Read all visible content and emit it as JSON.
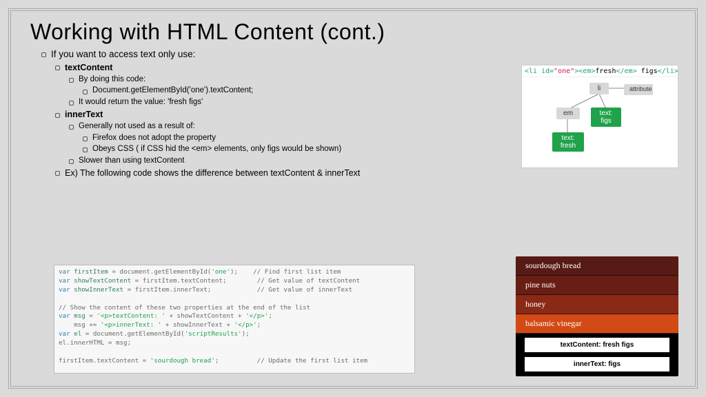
{
  "title": "Working with HTML Content (cont.)",
  "bullets": {
    "intro": "If you want to access text only use:",
    "textContent": {
      "label": "textContent",
      "sub1": "By doing this code:",
      "code": "Document.getElementById('one').textContent;",
      "sub2": "It would return the value: 'fresh figs'"
    },
    "innerText": {
      "label": "innerText",
      "sub1": "Generally not used as a result of:",
      "f1": "Firefox does not adopt the property",
      "f2": "Obeys CSS ( if CSS hid the <em> elements, only figs would be shown)",
      "f3": "Slower than using textContent"
    },
    "ex": "Ex) The following code shows the difference between textContent & innerText"
  },
  "diagram": {
    "codeline_html": "<li id=\"one\"><em>fresh</em> figs</li>",
    "node_li": "li",
    "node_attr": "attribute",
    "node_em": "em",
    "node_text_figs": "text: figs",
    "node_text_fresh": "text: fresh"
  },
  "code_block": {
    "l1": "var firstItem = document.getElementById('one');    // Find first list item",
    "l2": "var showTextContent = firstItem.textContent;        // Get value of textContent",
    "l3": "var showInnerText = firstItem.innerText;            // Get value of innerText",
    "l4": "",
    "l5": "// Show the content of these two properties at the end of the list",
    "l6": "var msg = '<p>textContent: ' + showTextContent + '</p>';",
    "l7": "    msg += '<p>innerText: ' + showInnerText + '</p>';",
    "l8": "var el = document.getElementById('scriptResults');",
    "l9": "el.innerHTML = msg;",
    "l10": "",
    "l11": "firstItem.textContent = 'sourdough bread';          // Update the first list item"
  },
  "result_panel": {
    "rows": [
      "sourdough bread",
      "pine nuts",
      "honey",
      "balsamic vinegar"
    ],
    "row_colors": [
      "#571a14",
      "#681e14",
      "#8a2a16",
      "#d24a15"
    ],
    "btn1": "textContent: fresh figs",
    "btn2": "innerText: figs"
  }
}
